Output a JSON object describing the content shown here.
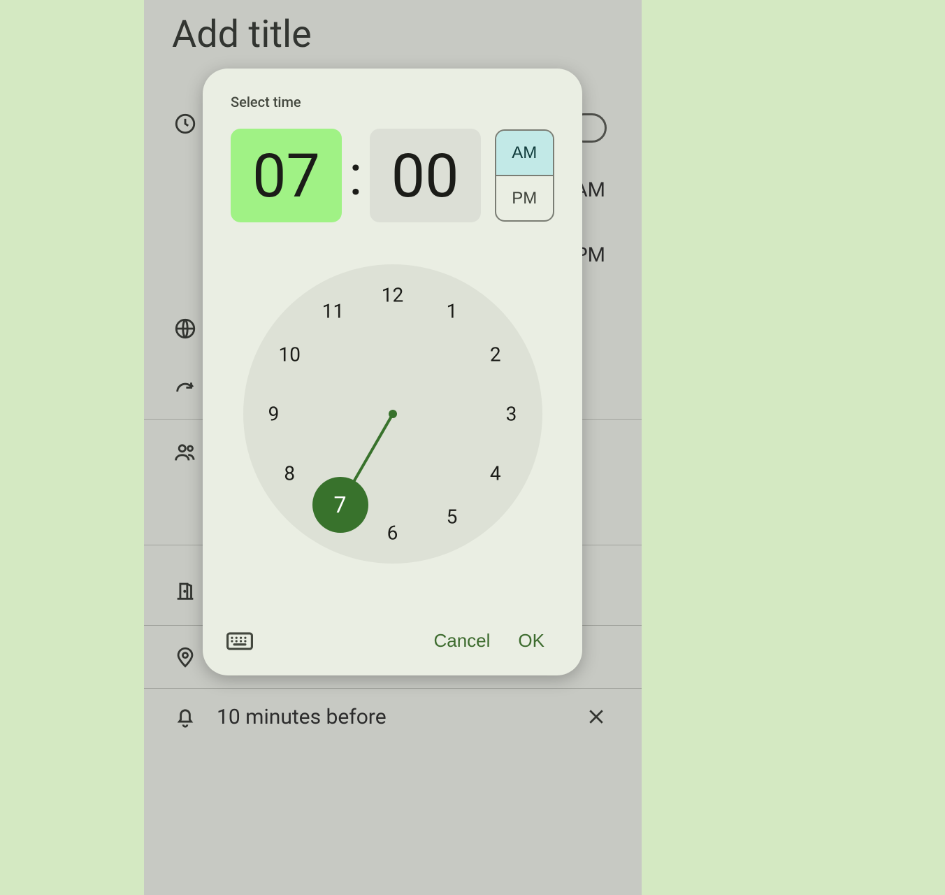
{
  "background": {
    "title_placeholder": "Add title",
    "time_right_1_suffix": "AM",
    "time_right_2_suffix": "PM",
    "notification_label": "10 minutes before"
  },
  "dialog": {
    "title": "Select time",
    "hour": "07",
    "minute": "00",
    "am_label": "AM",
    "pm_label": "PM",
    "selected_hour": 7,
    "selected_period": "AM",
    "clock_hours": [
      12,
      1,
      2,
      3,
      4,
      5,
      6,
      7,
      8,
      9,
      10,
      11
    ],
    "cancel_label": "Cancel",
    "ok_label": "OK"
  },
  "colors": {
    "accent": "#38722c",
    "hour_bg": "#a0f285",
    "am_selected_bg": "#c2e9e7"
  }
}
